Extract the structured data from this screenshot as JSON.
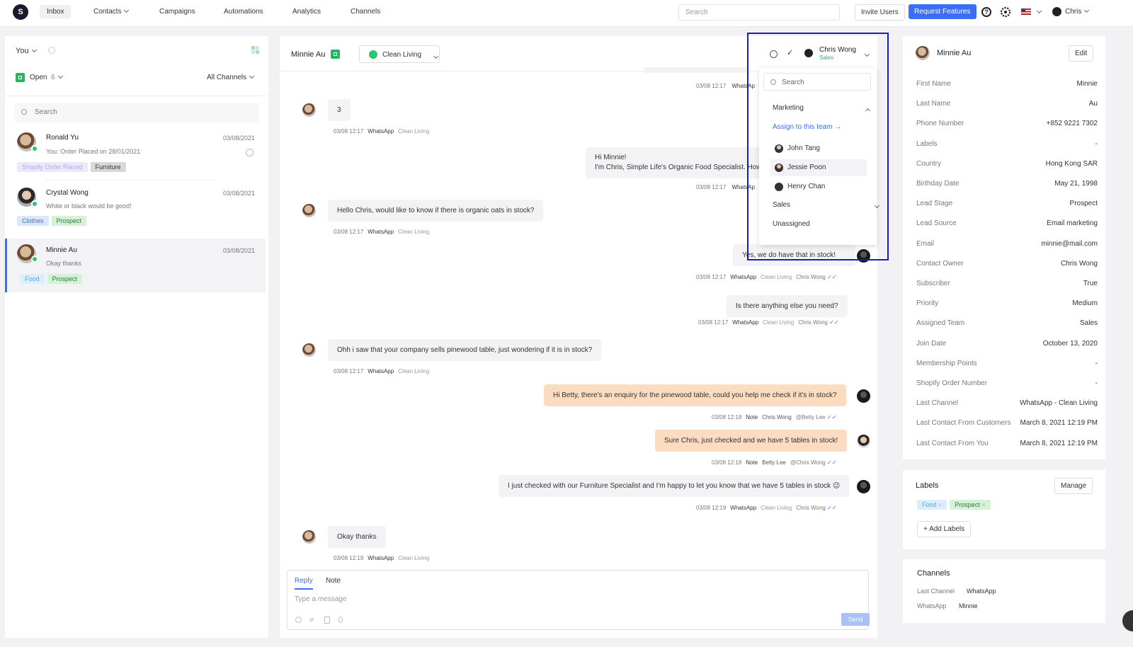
{
  "nav": {
    "logo": "S",
    "items": [
      "Inbox",
      "Contacts",
      "Campaigns",
      "Automations",
      "Analytics",
      "Channels"
    ],
    "search_placeholder": "Search",
    "invite": "Invite Users",
    "request": "Request Features",
    "user": "Chris",
    "help_glyph": "?",
    "flag_icon": "us-flag-icon"
  },
  "left": {
    "assignee": "You",
    "status": "Open",
    "count": "6",
    "channels": "All Channels",
    "search_placeholder": "Search",
    "conversations": [
      {
        "name": "Ronald Yu",
        "date": "03/08/2021",
        "preview": "You: Order Placed on 28/01/2021",
        "tags": [
          "Shopify Order Placed",
          "Furniture"
        ]
      },
      {
        "name": "Crystal Wong",
        "date": "03/08/2021",
        "preview": "White or black would be good!",
        "tags": [
          "Clothes",
          "Prospect"
        ]
      },
      {
        "name": "Minnie Au",
        "date": "03/08/2021",
        "preview": "Okay thanks",
        "tags": [
          "Food",
          "Prospect"
        ]
      }
    ]
  },
  "chat": {
    "contact": "Minnie Au",
    "channel": "Clean Living",
    "assignee_name": "Chris Wong",
    "assignee_team": "Sales",
    "messages": [
      {
        "text": "3",
        "time": "03/08 12:17",
        "ch": "WhatsApp",
        "sub": "Clean Living"
      },
      {
        "text1": "Hi Minnie!",
        "text2": "I'm Chris, Simple Life's Organic Food Specialist. How",
        "time": "03/08 12:17",
        "ch": "WhatsAp"
      },
      {
        "text": "Hello Chris, would like to know if there is organic oats in stock?",
        "time": "03/08 12:17",
        "ch": "WhatsApp",
        "sub": "Clean Living"
      },
      {
        "text": "Yes, we do have that in stock!",
        "time": "03/08 12:17",
        "ch": "WhatsApp",
        "sub": "Clean Living",
        "by": "Chris Wong"
      },
      {
        "text": "Is there anything else you need?",
        "time": "03/08 12:17",
        "ch": "WhatsApp",
        "sub": "Clean Living",
        "by": "Chris Wong"
      },
      {
        "text": "Ohh i saw that your company sells pinewood table, just wondering if it is in stock?",
        "time": "03/08 12:17",
        "ch": "WhatsApp",
        "sub": "Clean Living"
      },
      {
        "text": "Hi Betty, there's an enquiry for the pinewood table, could you help me check if it's in stock?",
        "time": "03/08 12:18",
        "ch": "Note",
        "sub": "Chris Wong",
        "by": "@Betty Lee"
      },
      {
        "text": "Sure Chris, just checked and we have 5 tables in stock!",
        "time": "03/08 12:18",
        "ch": "Note",
        "sub": "Betty Lee",
        "by": "@Chris Wong"
      },
      {
        "text": "I just checked with our Furniture Specialist and I'm happy to let you know that we have 5 tables in stock 😉",
        "time": "03/08 12:19",
        "ch": "WhatsApp",
        "sub": "Clean Living",
        "by": "Chris Wong"
      },
      {
        "text": "Okay thanks",
        "time": "03/08 12:19",
        "ch": "WhatsApp",
        "sub": "Clean Living"
      }
    ],
    "reply_tab": "Reply",
    "note_tab": "Note",
    "placeholder": "Type a message",
    "send": "Send"
  },
  "dropdown": {
    "search_placeholder": "Search",
    "team1": "Marketing",
    "assign_team": "Assign to this team",
    "members": [
      "John Tang",
      "Jessie Poon",
      "Henry Chan"
    ],
    "team2": "Sales",
    "unassigned": "Unassigned"
  },
  "profile": {
    "name": "Minnie Au",
    "edit": "Edit",
    "fields": [
      {
        "k": "First Name",
        "v": "Minnie"
      },
      {
        "k": "Last Name",
        "v": "Au"
      },
      {
        "k": "Phone Number",
        "v": "+852 9221 7302"
      },
      {
        "k": "Labels",
        "v": "-"
      },
      {
        "k": "Country",
        "v": "Hong Kong SAR"
      },
      {
        "k": "Birthday Date",
        "v": "May 21, 1998"
      },
      {
        "k": "Lead Stage",
        "v": "Prospect"
      },
      {
        "k": "Lead Source",
        "v": "Email marketing"
      },
      {
        "k": "Email",
        "v": "minnie@mail.com"
      },
      {
        "k": "Contact Owner",
        "v": "Chris Wong"
      },
      {
        "k": "Subscriber",
        "v": "True"
      },
      {
        "k": "Priority",
        "v": "Medium"
      },
      {
        "k": "Assigned Team",
        "v": "Sales"
      },
      {
        "k": "Join Date",
        "v": "October 13, 2020"
      },
      {
        "k": "Membership Points",
        "v": "-"
      },
      {
        "k": "Shopify Order Number",
        "v": "-"
      },
      {
        "k": "Last Channel",
        "v": "WhatsApp - Clean Living"
      },
      {
        "k": "Last Contact From Customers",
        "v": "March 8, 2021 12:19 PM"
      },
      {
        "k": "Last Contact From You",
        "v": "March 8, 2021 12:19 PM"
      }
    ]
  },
  "labels": {
    "title": "Labels",
    "manage": "Manage",
    "items": [
      "Food",
      "Prospect"
    ],
    "add": "+ Add Labels"
  },
  "channels": {
    "title": "Channels",
    "last_label": "Last Channel",
    "last_value": "WhatsApp",
    "wa_label": "WhatsApp",
    "wa_value": "Minnie"
  }
}
